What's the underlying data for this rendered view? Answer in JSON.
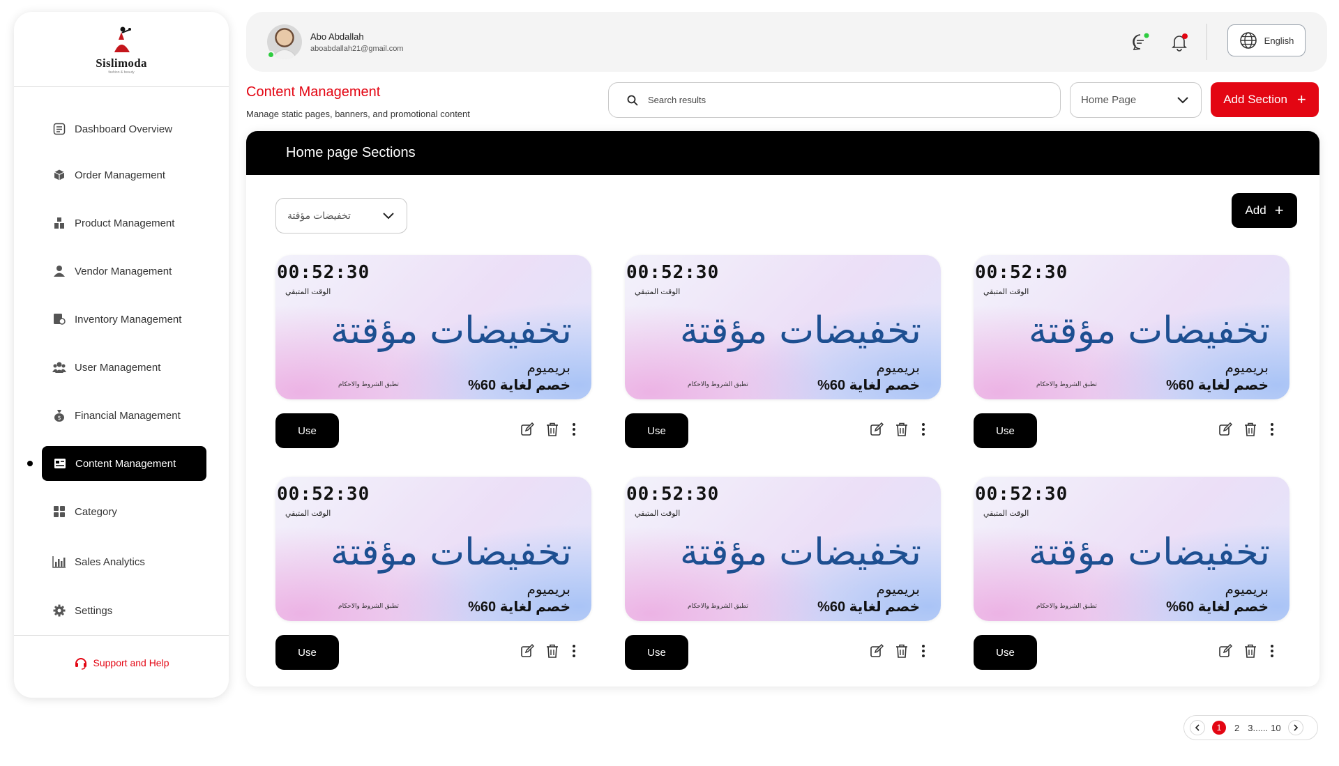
{
  "brand": {
    "name": "Sislimoda",
    "tagline": "fashion & beauty",
    "accent": "#e30613"
  },
  "sidebar": {
    "items": [
      {
        "label": "Dashboard Overview",
        "icon": "dashboard-icon"
      },
      {
        "label": "Order Management",
        "icon": "box-icon"
      },
      {
        "label": "Product Management",
        "icon": "products-icon"
      },
      {
        "label": "Vendor Management",
        "icon": "vendor-icon"
      },
      {
        "label": "Inventory Management",
        "icon": "inventory-icon"
      },
      {
        "label": "User Management",
        "icon": "users-icon"
      },
      {
        "label": "Financial Management",
        "icon": "money-bag-icon"
      },
      {
        "label": "Content Management",
        "icon": "content-icon",
        "active": true
      },
      {
        "label": "Category",
        "icon": "grid-icon"
      },
      {
        "label": "Sales Analytics",
        "icon": "chart-icon"
      },
      {
        "label": "Settings",
        "icon": "gear-icon"
      }
    ],
    "support": "Support and Help"
  },
  "header": {
    "user_name": "Abo Abdallah",
    "user_email": "aboabdallah21@gmail.com",
    "language": "English"
  },
  "page": {
    "title": "Content Management",
    "subtitle": "Manage static pages, banners, and promotional content",
    "search_placeholder": "Search results",
    "page_select": "Home Page",
    "add_section": "Add Section"
  },
  "panel": {
    "title": "Home page Sections",
    "filter": "تخفيضات مؤقتة",
    "add": "Add"
  },
  "cards": [
    {
      "timer": "00:52:30",
      "timer_label": "الوقت المتبقي",
      "title": "تخفيضات مؤقتة",
      "brand": "بريميوم",
      "discount": "خصم لغاية 60%",
      "terms": "تطبق الشروط والاحكام",
      "use": "Use"
    },
    {
      "timer": "00:52:30",
      "timer_label": "الوقت المتبقي",
      "title": "تخفيضات مؤقتة",
      "brand": "بريميوم",
      "discount": "خصم لغاية 60%",
      "terms": "تطبق الشروط والاحكام",
      "use": "Use"
    },
    {
      "timer": "00:52:30",
      "timer_label": "الوقت المتبقي",
      "title": "تخفيضات مؤقتة",
      "brand": "بريميوم",
      "discount": "خصم لغاية 60%",
      "terms": "تطبق الشروط والاحكام",
      "use": "Use"
    },
    {
      "timer": "00:52:30",
      "timer_label": "الوقت المتبقي",
      "title": "تخفيضات مؤقتة",
      "brand": "بريميوم",
      "discount": "خصم لغاية 60%",
      "terms": "تطبق الشروط والاحكام",
      "use": "Use"
    },
    {
      "timer": "00:52:30",
      "timer_label": "الوقت المتبقي",
      "title": "تخفيضات مؤقتة",
      "brand": "بريميوم",
      "discount": "خصم لغاية 60%",
      "terms": "تطبق الشروط والاحكام",
      "use": "Use"
    },
    {
      "timer": "00:52:30",
      "timer_label": "الوقت المتبقي",
      "title": "تخفيضات مؤقتة",
      "brand": "بريميوم",
      "discount": "خصم لغاية 60%",
      "terms": "تطبق الشروط والاحكام",
      "use": "Use"
    }
  ],
  "pagination": {
    "current": "1",
    "pages": [
      "2",
      "3......",
      "10"
    ]
  }
}
